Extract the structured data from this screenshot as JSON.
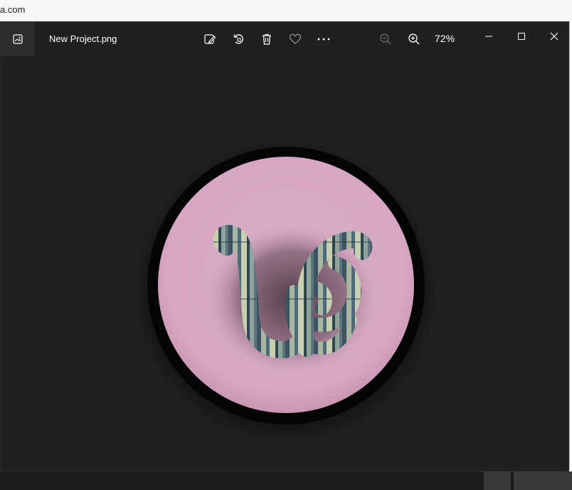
{
  "browser": {
    "url_fragment": "a.com"
  },
  "viewer": {
    "file_name": "New Project.png",
    "zoom": "72%",
    "toolbar": {
      "edit_icon": "edit-image-icon",
      "rotate_icon": "rotate-icon",
      "delete_icon": "delete-icon",
      "favorite_icon": "heart-icon",
      "more_icon": "more-options-icon",
      "zoom_out_icon": "zoom-out-icon",
      "zoom_in_icon": "zoom-in-icon"
    },
    "window_controls": [
      "minimize",
      "maximize",
      "close"
    ]
  },
  "image": {
    "description_colors": {
      "background": "#202020",
      "ring": "#050505",
      "disc": "#d9a9c5",
      "glyph_wood_a": "#6f8a8a",
      "glyph_wood_b": "#c7cfb2",
      "glyph_wood_c": "#3d5560"
    }
  }
}
